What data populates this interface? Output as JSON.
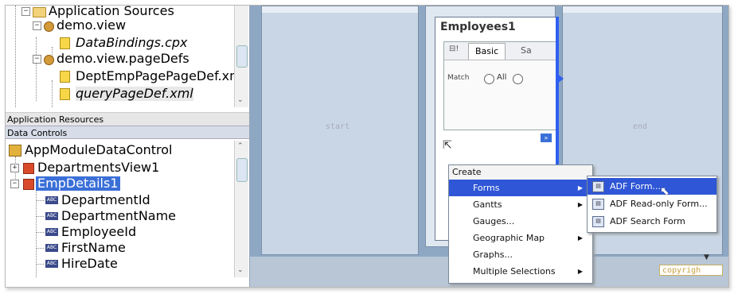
{
  "app_sources": {
    "root": "Application Sources",
    "pkg1": "demo.view",
    "file1": "DataBindings.cpx",
    "pkg2": "demo.view.pageDefs",
    "file2": "DeptEmpPagePageDef.xml",
    "file3": "queryPageDef.xml"
  },
  "sections": {
    "app_resources": "Application Resources",
    "data_controls": "Data Controls"
  },
  "data_controls": {
    "root": "AppModuleDataControl",
    "item1": "DepartmentsView1",
    "item2": "EmpDetails1",
    "attrs": [
      "DepartmentId",
      "DepartmentName",
      "EmployeeId",
      "FirstName",
      "HireDate"
    ],
    "attr_icon_text": "ABC"
  },
  "canvas": {
    "start_label": "start",
    "end_label": "end",
    "copyright": "copyrigh"
  },
  "employees_panel": {
    "title": "Employees1",
    "tab_basic": "Basic",
    "tab_next": "Sa",
    "match_label": "Match",
    "radio_all": "All"
  },
  "context_menu": {
    "header": "Create",
    "items": [
      "Forms",
      "Gantts",
      "Gauges...",
      "Geographic Map",
      "Graphs...",
      "Multiple Selections"
    ]
  },
  "submenu": {
    "items": [
      "ADF Form...",
      "ADF Read-only Form...",
      "ADF Search Form"
    ]
  },
  "colors": {
    "selection": "#2f56d6",
    "canvas_bg": "#c9d6e5"
  }
}
